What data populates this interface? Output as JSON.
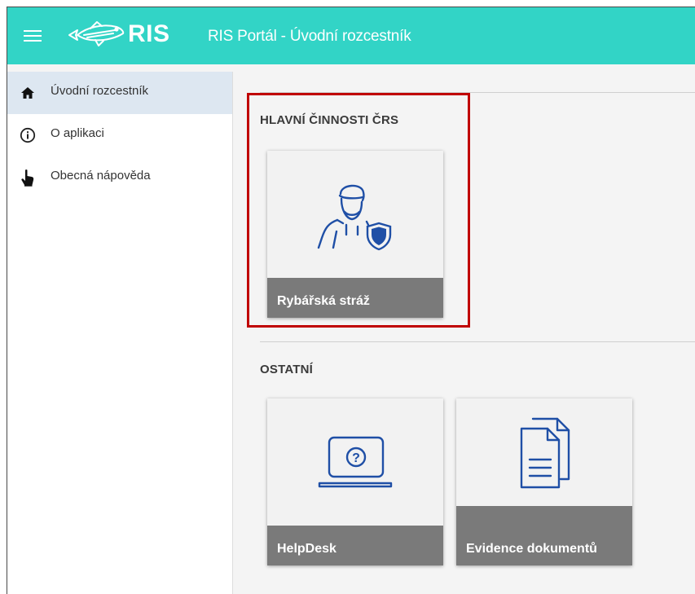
{
  "header": {
    "logo_text": "RIS",
    "title": "RIS Portál - Úvodní rozcestník",
    "menu_icon": "hamburger-icon",
    "logo_icon": "fish-logo-icon",
    "background_color": "#32d4c6"
  },
  "sidebar": {
    "items": [
      {
        "label": "Úvodní rozcestník",
        "icon": "home-icon",
        "active": true
      },
      {
        "label": "O aplikaci",
        "icon": "info-icon",
        "active": false
      },
      {
        "label": "Obecná nápověda",
        "icon": "pointing-hand-icon",
        "active": false
      }
    ]
  },
  "main": {
    "sections": [
      {
        "title": "HLAVNÍ ČINNOSTI ČRS",
        "tiles": [
          {
            "label": "Rybářská stráž",
            "icon": "guard-shield-icon"
          }
        ]
      },
      {
        "title": "OSTATNÍ",
        "tiles": [
          {
            "label": "HelpDesk",
            "icon": "laptop-question-icon"
          },
          {
            "label": "Evidence dokumentů",
            "icon": "documents-icon"
          }
        ]
      }
    ],
    "highlight_color": "#c00000",
    "icon_color": "#1f4fa6"
  }
}
